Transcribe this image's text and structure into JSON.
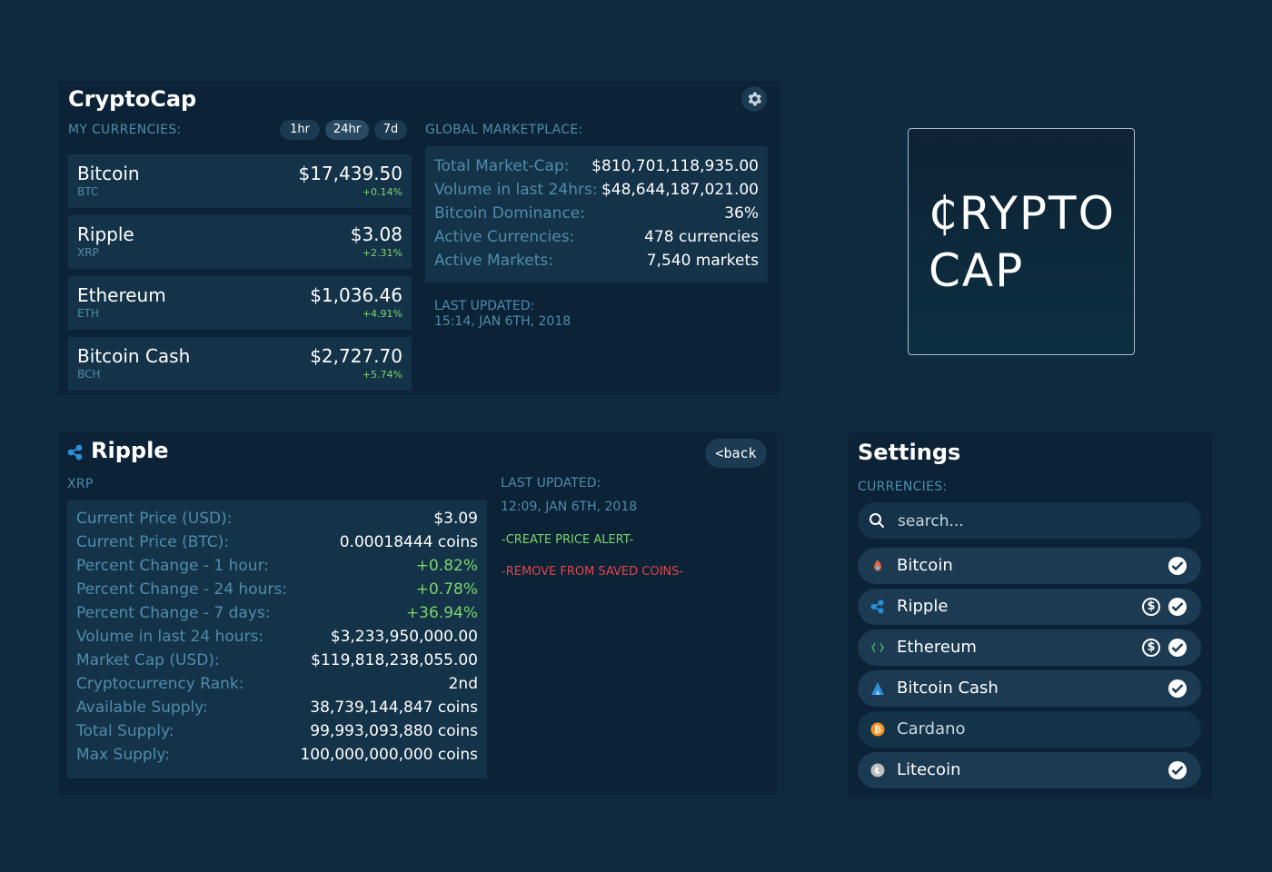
{
  "app": {
    "title": "CryptoCap",
    "my_currencies_label": "MY CURRENCIES:",
    "time_filters": [
      "1hr",
      "24hr",
      "7d"
    ],
    "active_filter": "24hr",
    "global_label": "GLOBAL MARKETPLACE:"
  },
  "currencies": [
    {
      "name": "Bitcoin",
      "symbol": "BTC",
      "price": "$17,439.50",
      "change": "+0.14%"
    },
    {
      "name": "Ripple",
      "symbol": "XRP",
      "price": "$3.08",
      "change": "+2.31%"
    },
    {
      "name": "Ethereum",
      "symbol": "ETH",
      "price": "$1,036.46",
      "change": "+4.91%"
    },
    {
      "name": "Bitcoin Cash",
      "symbol": "BCH",
      "price": "$2,727.70",
      "change": "+5.74%"
    }
  ],
  "global": {
    "rows": [
      {
        "label": "Total Market-Cap:",
        "value": "$810,701,118,935.00"
      },
      {
        "label": "Volume in last 24hrs:",
        "value": "$48,644,187,021.00"
      },
      {
        "label": "Bitcoin Dominance:",
        "value": "36%"
      },
      {
        "label": "Active Currencies:",
        "value": "478 currencies"
      },
      {
        "label": "Active Markets:",
        "value": "7,540 markets"
      }
    ],
    "last_updated_label": "LAST UPDATED:",
    "last_updated_value": "15:14, JAN 6TH, 2018"
  },
  "logo": {
    "line1": "₵RYPTO",
    "line2": "CAP"
  },
  "detail": {
    "title": "Ripple",
    "symbol": "XRP",
    "back_label": "<back",
    "rows": [
      {
        "label": "Current Price (USD):",
        "value": "$3.09",
        "positive": false
      },
      {
        "label": "Current Price (BTC):",
        "value": "0.00018444 coins",
        "positive": false
      },
      {
        "label": "Percent Change - 1 hour:",
        "value": "+0.82%",
        "positive": true
      },
      {
        "label": "Percent Change - 24 hours:",
        "value": "+0.78%",
        "positive": true
      },
      {
        "label": "Percent Change - 7 days:",
        "value": "+36.94%",
        "positive": true
      },
      {
        "label": "Volume in last 24 hours:",
        "value": "$3,233,950,000.00",
        "positive": false
      },
      {
        "label": "Market Cap (USD):",
        "value": "$119,818,238,055.00",
        "positive": false
      },
      {
        "label": "Cryptocurrency Rank:",
        "value": "2nd",
        "positive": false
      },
      {
        "label": "Available Supply:",
        "value": "38,739,144,847 coins",
        "positive": false
      },
      {
        "label": "Total Supply:",
        "value": "99,993,093,880 coins",
        "positive": false
      },
      {
        "label": "Max Supply:",
        "value": "100,000,000,000 coins",
        "positive": false
      }
    ],
    "last_updated_label": "LAST UPDATED:",
    "last_updated_value": "12:09, JAN 6TH, 2018",
    "create_alert": "-CREATE PRICE ALERT-",
    "remove_saved": "-REMOVE FROM SAVED COINS-"
  },
  "settings": {
    "title": "Settings",
    "currencies_label": "CURRENCIES:",
    "search_placeholder": "search...",
    "items": [
      {
        "name": "Bitcoin",
        "icon": "bitcoin-icon",
        "saved": true,
        "alert": false
      },
      {
        "name": "Ripple",
        "icon": "ripple-icon",
        "saved": true,
        "alert": true
      },
      {
        "name": "Ethereum",
        "icon": "ethereum-icon",
        "saved": true,
        "alert": true
      },
      {
        "name": "Bitcoin Cash",
        "icon": "bitcoin-cash-icon",
        "saved": true,
        "alert": false
      },
      {
        "name": "Cardano",
        "icon": "cardano-icon",
        "saved": false,
        "alert": false
      },
      {
        "name": "Litecoin",
        "icon": "litecoin-icon",
        "saved": true,
        "alert": false
      }
    ]
  },
  "colors": {
    "background": "#0f2a3f",
    "panel": "#0c2236",
    "card": "#143349",
    "label_blue": "#4f8cab",
    "positive_green": "#7ed46a",
    "alert_green": "#7ed46a",
    "remove_red": "#e0474c"
  }
}
